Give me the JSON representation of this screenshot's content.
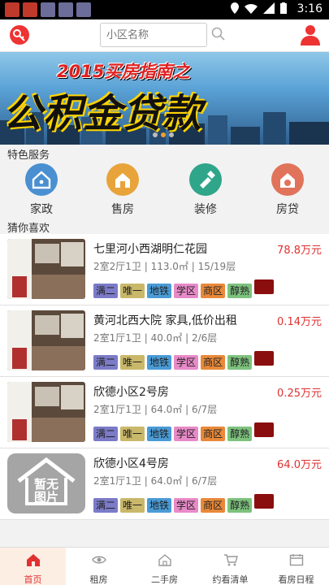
{
  "status_bar": {
    "time": "3:16",
    "notification_colors": [
      "#c0392b",
      "#c0392b",
      "#6d6d9a",
      "#6d6d9a",
      "#6d6d9a"
    ]
  },
  "header": {
    "search_placeholder": "小区名称"
  },
  "banner": {
    "line1": "2015买房指南之",
    "line2": "公积金贷款",
    "slide_count": 3,
    "active_slide": 2
  },
  "sections": {
    "services_title": "特色服务",
    "recommend_title": "猜你喜欢"
  },
  "services": [
    {
      "label": "家政",
      "icon": "home-icon",
      "color": "#4a8fd0"
    },
    {
      "label": "售房",
      "icon": "house-icon",
      "color": "#e8a43a"
    },
    {
      "label": "装修",
      "icon": "brush-icon",
      "color": "#2fa58a"
    },
    {
      "label": "房贷",
      "icon": "loan-icon",
      "color": "#e0735a"
    }
  ],
  "listings": [
    {
      "name": "七里河小西湖明仁花园",
      "price": "78.8万元",
      "rooms": "2室2厅1卫",
      "area": "113.0㎡",
      "floor": "15/19层",
      "image": "photo"
    },
    {
      "name": "黄河北西大院 家具,低价出租",
      "price": "0.14万元",
      "rooms": "2室1厅1卫",
      "area": "40.0㎡",
      "floor": "2/6层",
      "image": "photo"
    },
    {
      "name": "欣德小区2号房",
      "price": "0.25万元",
      "rooms": "2室1厅1卫",
      "area": "64.0㎡",
      "floor": "6/7层",
      "image": "photo"
    },
    {
      "name": "欣德小区4号房",
      "price": "64.0万元",
      "rooms": "2室1厅1卫",
      "area": "64.0㎡",
      "floor": "6/7层",
      "image": "placeholder",
      "placeholder_text": "暂无图片"
    }
  ],
  "tags": [
    {
      "label": "满二",
      "color": "#7b7bc8"
    },
    {
      "label": "唯一",
      "color": "#c9b86a"
    },
    {
      "label": "地铁",
      "color": "#4a9bd6"
    },
    {
      "label": "学区",
      "color": "#e88ac8"
    },
    {
      "label": "商区",
      "color": "#e8893a"
    },
    {
      "label": "醇熟",
      "color": "#7dc27d"
    },
    {
      "label": "",
      "color": "#8b0e0e"
    }
  ],
  "tabs": [
    {
      "label": "首页",
      "icon": "home-icon",
      "active": true
    },
    {
      "label": "租房",
      "icon": "eye-icon",
      "active": false
    },
    {
      "label": "二手房",
      "icon": "house-icon",
      "active": false
    },
    {
      "label": "约看清单",
      "icon": "cart-icon",
      "active": false
    },
    {
      "label": "看房日程",
      "icon": "calendar-icon",
      "active": false
    }
  ]
}
